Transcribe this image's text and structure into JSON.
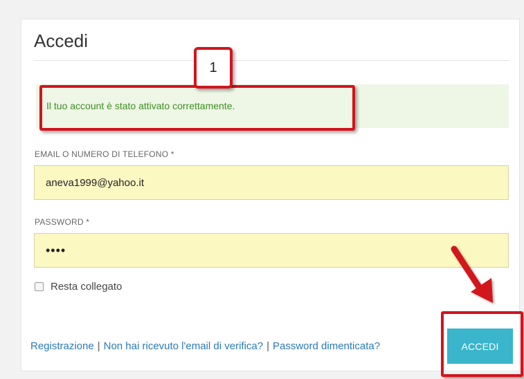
{
  "form": {
    "title": "Accedi",
    "success_message": "Il tuo account è stato attivato correttamente.",
    "email_label": "EMAIL O NUMERO DI TELEFONO *",
    "email_value": "aneva1999@yahoo.it",
    "password_label": "PASSWORD *",
    "password_value": "••••",
    "remember_label": "Resta collegato",
    "submit_label": "ACCEDI"
  },
  "links": {
    "register": "Registrazione",
    "separator": "|",
    "resend_verification": "Non hai ricevuto l'email di verifica?",
    "forgot_password": "Password dimenticata?"
  },
  "annotations": {
    "step_number": "1"
  },
  "colors": {
    "accent": "#3ab5cc",
    "success_text": "#3f8f23",
    "success_bg": "#eef6e6",
    "autofill_bg": "#fcf8c2",
    "annotation_red": "#d2141d",
    "link": "#2a7ab8"
  }
}
